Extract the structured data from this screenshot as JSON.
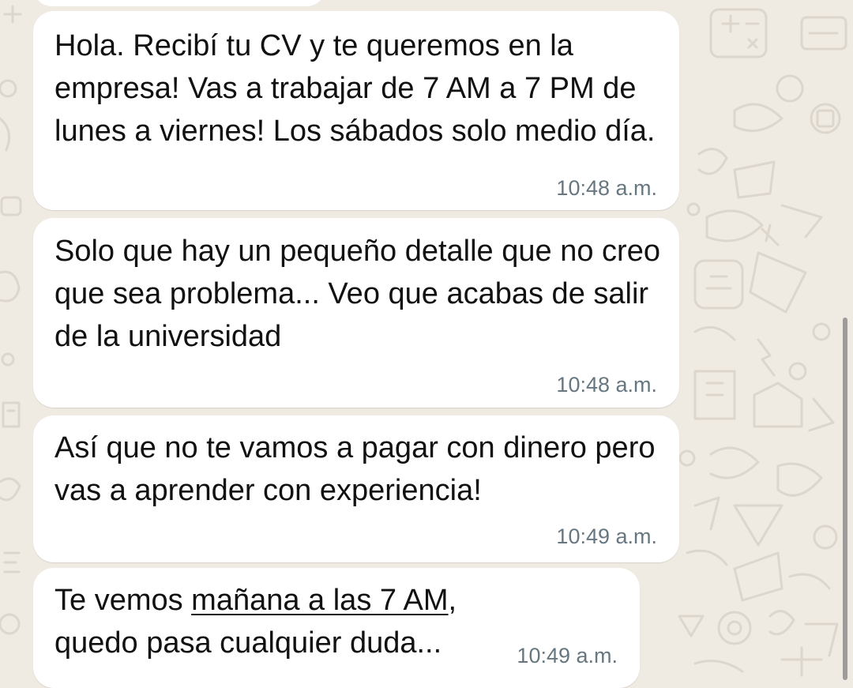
{
  "chat": {
    "messages": [
      {
        "text": "Hola. Recibí tu CV y te queremos en la empresa! Vas a trabajar de 7 AM a 7 PM de lunes a viernes! Los sábados solo medio día.",
        "time": "10:48 a.m."
      },
      {
        "text": "Solo que hay un pequeño detalle que no creo que sea problema... Veo que acabas de salir de la universidad",
        "time": "10:48 a.m."
      },
      {
        "text": "Así que no te vamos a pagar con dinero pero vas a aprender con experiencia!",
        "time": "10:49 a.m."
      },
      {
        "text_before": "Te vemos ",
        "link": "mañana a las 7 AM",
        "text_after": ", quedo pasa cualquier duda...",
        "time": "10:49 a.m."
      }
    ]
  },
  "colors": {
    "wallpaper": "#efeae2",
    "bubble": "#ffffff",
    "text": "#111111",
    "time": "#667781",
    "scrollbar": "#8e8e8e"
  },
  "icons": {
    "wallpaper_doodles": "whatsapp-doodle-pattern"
  }
}
